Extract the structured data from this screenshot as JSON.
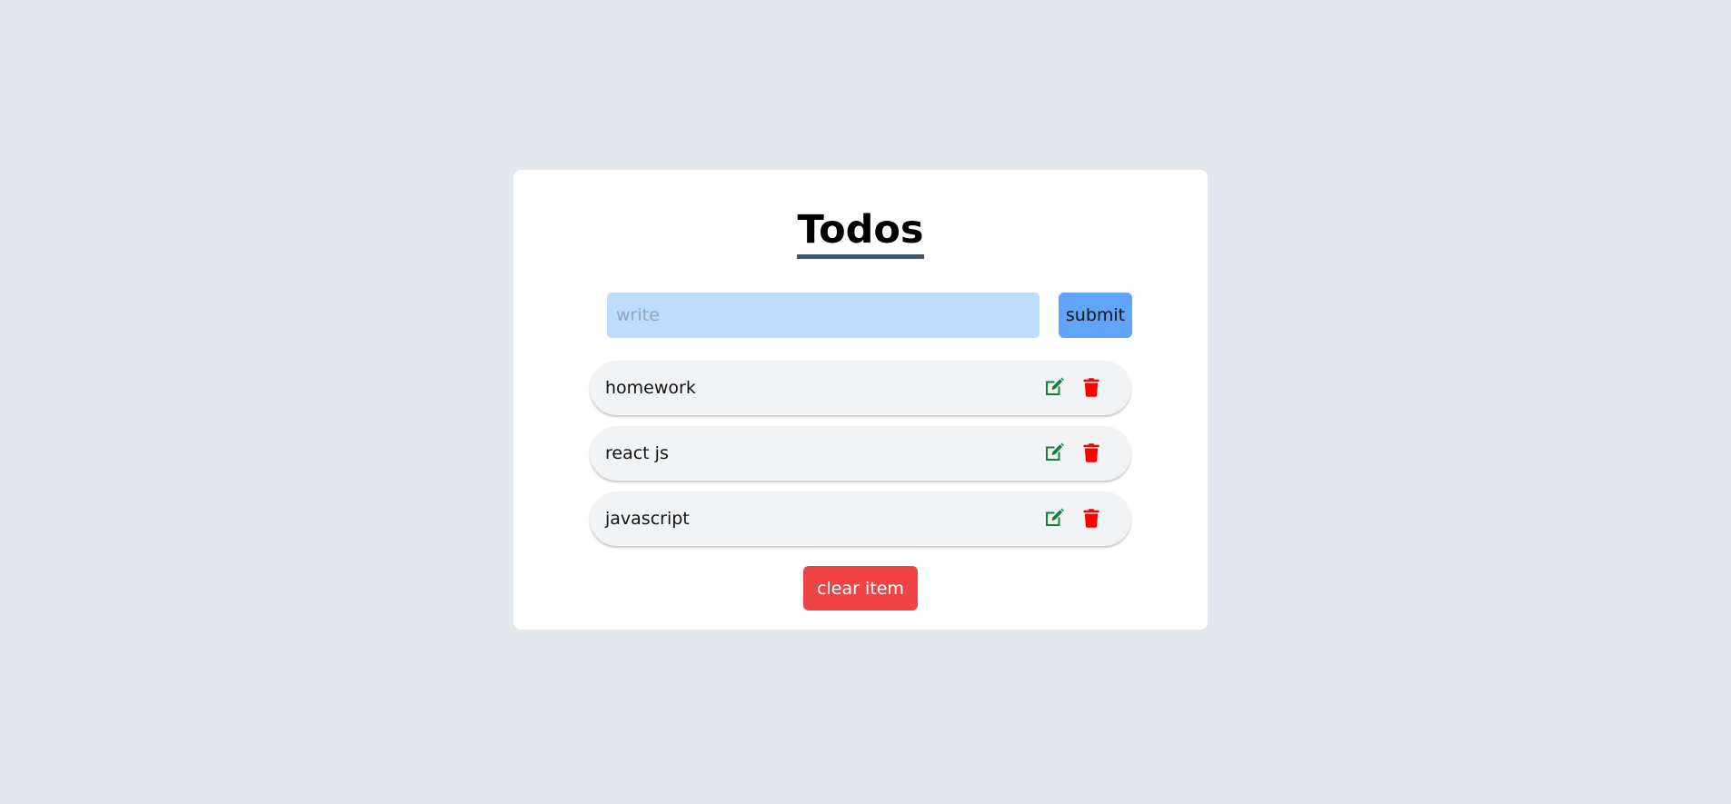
{
  "app": {
    "title": "Todos"
  },
  "form": {
    "input_value": "",
    "input_placeholder": "write",
    "submit_label": "submit"
  },
  "todos": [
    {
      "label": "homework",
      "edit_icon": "edit-icon",
      "delete_icon": "trash-icon"
    },
    {
      "label": "react js",
      "edit_icon": "edit-icon",
      "delete_icon": "trash-icon"
    },
    {
      "label": "javascript",
      "edit_icon": "edit-icon",
      "delete_icon": "trash-icon"
    }
  ],
  "footer": {
    "clear_label": "clear item"
  },
  "colors": {
    "background": "#e2e8f0",
    "input_bg": "#bfdbfe",
    "submit_bg": "#60a5fa",
    "clear_bg": "#ef4444",
    "edit_icon": "#15803d",
    "delete_icon": "#ff0000",
    "title_underline": "#475569"
  }
}
